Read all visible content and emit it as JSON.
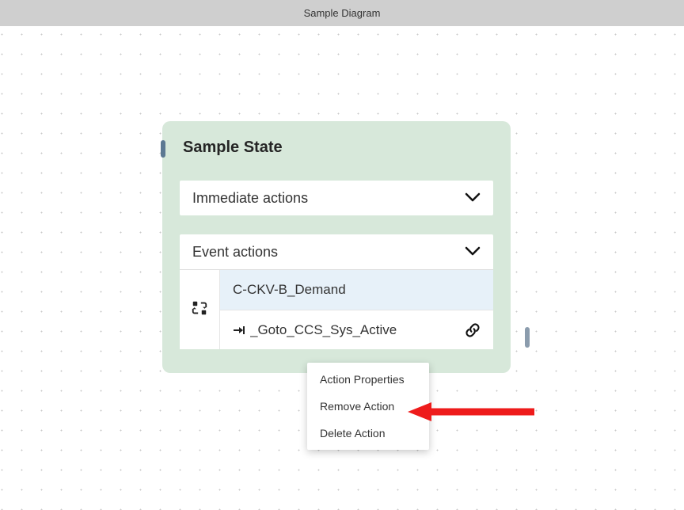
{
  "titlebar": {
    "text": "Sample Diagram"
  },
  "state": {
    "title": "Sample State",
    "sections": {
      "immediate": {
        "label": "Immediate actions"
      },
      "event": {
        "label": "Event actions",
        "event_name": "C-CKV-B_Demand",
        "transition_label": "_Goto_CCS_Sys_Active"
      }
    }
  },
  "context_menu": {
    "items": [
      {
        "label": "Action Properties"
      },
      {
        "label": "Remove Action"
      },
      {
        "label": "Delete Action"
      }
    ]
  }
}
